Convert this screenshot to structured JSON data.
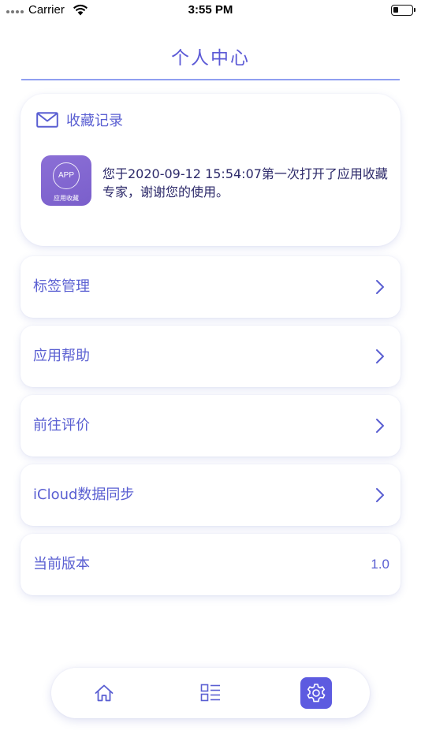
{
  "status_bar": {
    "carrier": "Carrier",
    "time": "3:55 PM",
    "icons": [
      "signal-dots-icon",
      "wifi-icon",
      "battery-icon"
    ]
  },
  "nav": {
    "title": "个人中心"
  },
  "favorites_card": {
    "icon": "mail-icon",
    "title": "收藏记录",
    "app_logo_text": "APP",
    "app_logo_label": "应用收藏",
    "message": "您于2020-09-12 15:54:07第一次打开了应用收藏专家，谢谢您的使用。"
  },
  "menu": {
    "items": [
      {
        "label": "标签管理",
        "icon": "chevron-right-icon"
      },
      {
        "label": "应用帮助",
        "icon": "chevron-right-icon"
      },
      {
        "label": "前往评价",
        "icon": "chevron-right-icon"
      },
      {
        "label": "iCloud数据同步",
        "icon": "chevron-right-icon"
      },
      {
        "label": "当前版本",
        "value": "1.0"
      }
    ]
  },
  "tab_bar": {
    "tabs": [
      {
        "icon": "home-icon",
        "active": false
      },
      {
        "icon": "list-icon",
        "active": false
      },
      {
        "icon": "gear-icon",
        "active": true
      }
    ]
  },
  "colors": {
    "accent": "#5a5fd2",
    "underline": "#8f9ff1",
    "active_tab": "#5d5be0",
    "app_logo": "#8068d0",
    "message_text": "#2d2a6a"
  }
}
